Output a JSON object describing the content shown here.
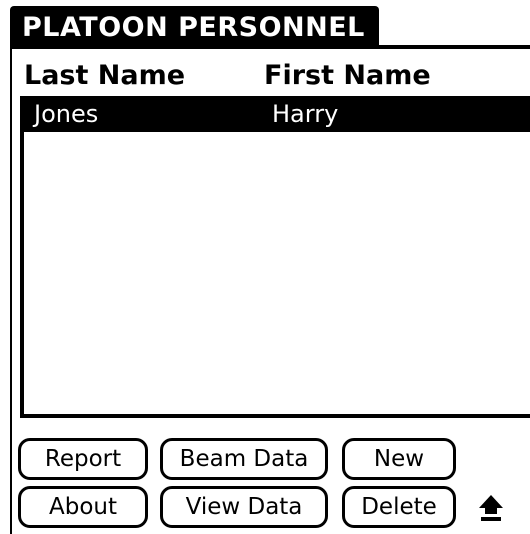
{
  "app": {
    "title": "PLATOON PERSONNEL"
  },
  "list": {
    "columns": [
      "Last Name",
      "First Name"
    ],
    "rows": [
      {
        "last": "Jones",
        "first": "Harry",
        "selected": true
      }
    ]
  },
  "buttons": {
    "report": "Report",
    "beam_data": "Beam Data",
    "new": "New",
    "about": "About",
    "view_data": "View Data",
    "delete": "Delete"
  },
  "icons": {
    "scroll_up": "up-arrow-icon"
  },
  "colors": {
    "foreground": "#000000",
    "background": "#ffffff"
  }
}
